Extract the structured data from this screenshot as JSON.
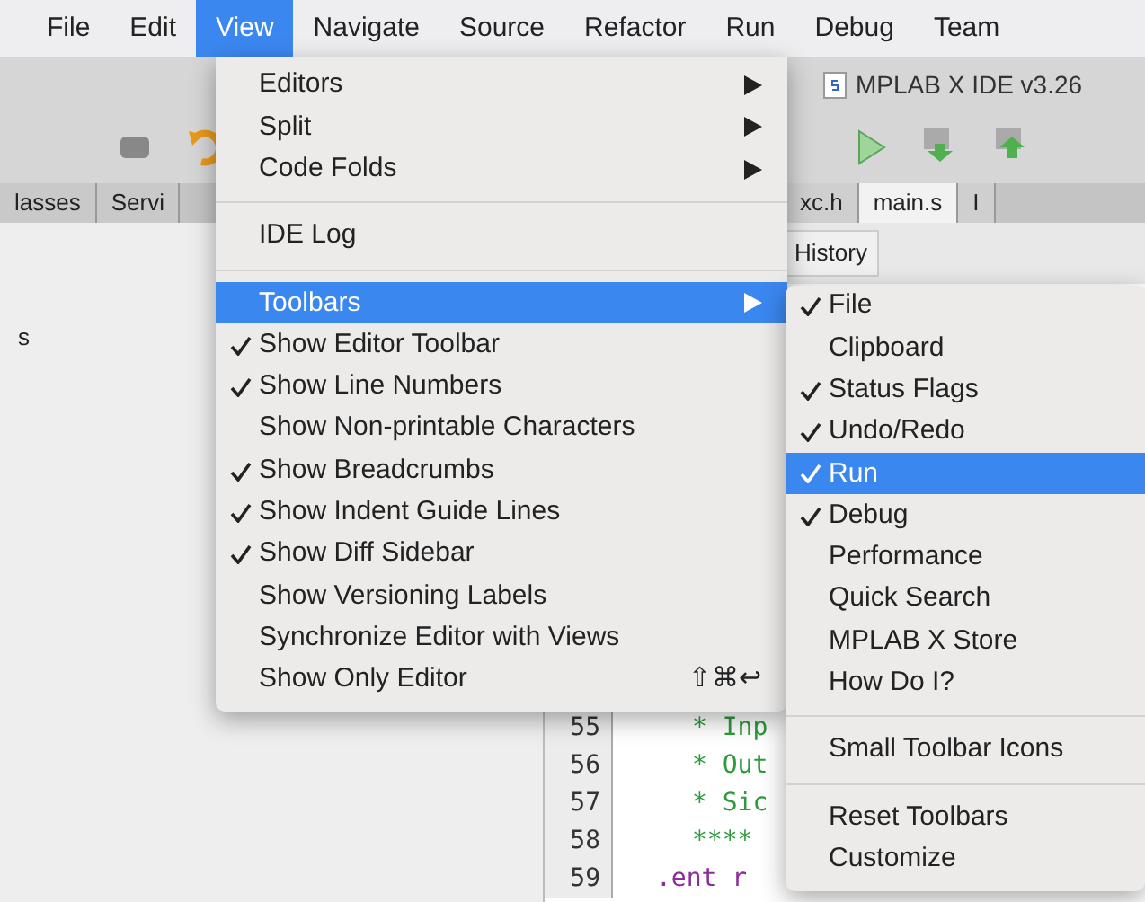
{
  "menubar": [
    {
      "label": "File",
      "selected": false
    },
    {
      "label": "Edit",
      "selected": false
    },
    {
      "label": "View",
      "selected": true
    },
    {
      "label": "Navigate",
      "selected": false
    },
    {
      "label": "Source",
      "selected": false
    },
    {
      "label": "Refactor",
      "selected": false
    },
    {
      "label": "Run",
      "selected": false
    },
    {
      "label": "Debug",
      "selected": false
    },
    {
      "label": "Team",
      "selected": false
    }
  ],
  "window_title": "MPLAB X IDE v3.26",
  "left_tabs": [
    "lasses",
    "Servi"
  ],
  "editor_tabs": [
    {
      "label": "xc.h",
      "selected": false
    },
    {
      "label": "main.s",
      "selected": true
    },
    {
      "label": "I",
      "selected": false
    }
  ],
  "editor_toolbar": {
    "history": "History"
  },
  "left_panel_text": "s",
  "code_lines": [
    {
      "number": "55",
      "text": "* Inp",
      "kind": "comment"
    },
    {
      "number": "56",
      "text": "* Out",
      "kind": "comment"
    },
    {
      "number": "57",
      "text": "* Sic",
      "kind": "comment"
    },
    {
      "number": "58",
      "text": "****",
      "kind": "comment"
    },
    {
      "number": "59",
      "text": ".ent r",
      "kind": "directive"
    }
  ],
  "view_menu": [
    {
      "kind": "submenu",
      "label": "Editors",
      "checked": false,
      "selected": false
    },
    {
      "kind": "submenu",
      "label": "Split",
      "checked": false,
      "selected": false
    },
    {
      "kind": "submenu",
      "label": "Code Folds",
      "checked": false,
      "selected": false
    },
    {
      "kind": "separator"
    },
    {
      "kind": "item",
      "label": "IDE Log",
      "checked": false,
      "selected": false
    },
    {
      "kind": "separator"
    },
    {
      "kind": "submenu",
      "label": "Toolbars",
      "checked": false,
      "selected": true
    },
    {
      "kind": "item",
      "label": "Show Editor Toolbar",
      "checked": true,
      "selected": false
    },
    {
      "kind": "item",
      "label": "Show Line Numbers",
      "checked": true,
      "selected": false
    },
    {
      "kind": "item",
      "label": "Show Non-printable Characters",
      "checked": false,
      "selected": false
    },
    {
      "kind": "item",
      "label": "Show Breadcrumbs",
      "checked": true,
      "selected": false
    },
    {
      "kind": "item",
      "label": "Show Indent Guide Lines",
      "checked": true,
      "selected": false
    },
    {
      "kind": "item",
      "label": "Show Diff Sidebar",
      "checked": true,
      "selected": false
    },
    {
      "kind": "item",
      "label": "Show Versioning Labels",
      "checked": false,
      "selected": false
    },
    {
      "kind": "item",
      "label": "Synchronize Editor with Views",
      "checked": false,
      "selected": false
    },
    {
      "kind": "item",
      "label": "Show Only Editor",
      "checked": false,
      "selected": false,
      "shortcut": "⇧⌘↩"
    }
  ],
  "toolbars_menu": [
    {
      "kind": "item",
      "label": "File",
      "checked": true,
      "selected": false
    },
    {
      "kind": "item",
      "label": "Clipboard",
      "checked": false,
      "selected": false
    },
    {
      "kind": "item",
      "label": "Status Flags",
      "checked": true,
      "selected": false
    },
    {
      "kind": "item",
      "label": "Undo/Redo",
      "checked": true,
      "selected": false
    },
    {
      "kind": "item",
      "label": "Run",
      "checked": true,
      "selected": true
    },
    {
      "kind": "item",
      "label": "Debug",
      "checked": true,
      "selected": false
    },
    {
      "kind": "item",
      "label": "Performance",
      "checked": false,
      "selected": false
    },
    {
      "kind": "item",
      "label": "Quick Search",
      "checked": false,
      "selected": false
    },
    {
      "kind": "item",
      "label": "MPLAB X Store",
      "checked": false,
      "selected": false
    },
    {
      "kind": "item",
      "label": "How Do I?",
      "checked": false,
      "selected": false
    },
    {
      "kind": "separator"
    },
    {
      "kind": "item",
      "label": "Small Toolbar Icons",
      "checked": false,
      "selected": false
    },
    {
      "kind": "separator"
    },
    {
      "kind": "item",
      "label": "Reset Toolbars",
      "checked": false,
      "selected": false
    },
    {
      "kind": "item",
      "label": "Customize",
      "checked": false,
      "selected": false
    }
  ]
}
